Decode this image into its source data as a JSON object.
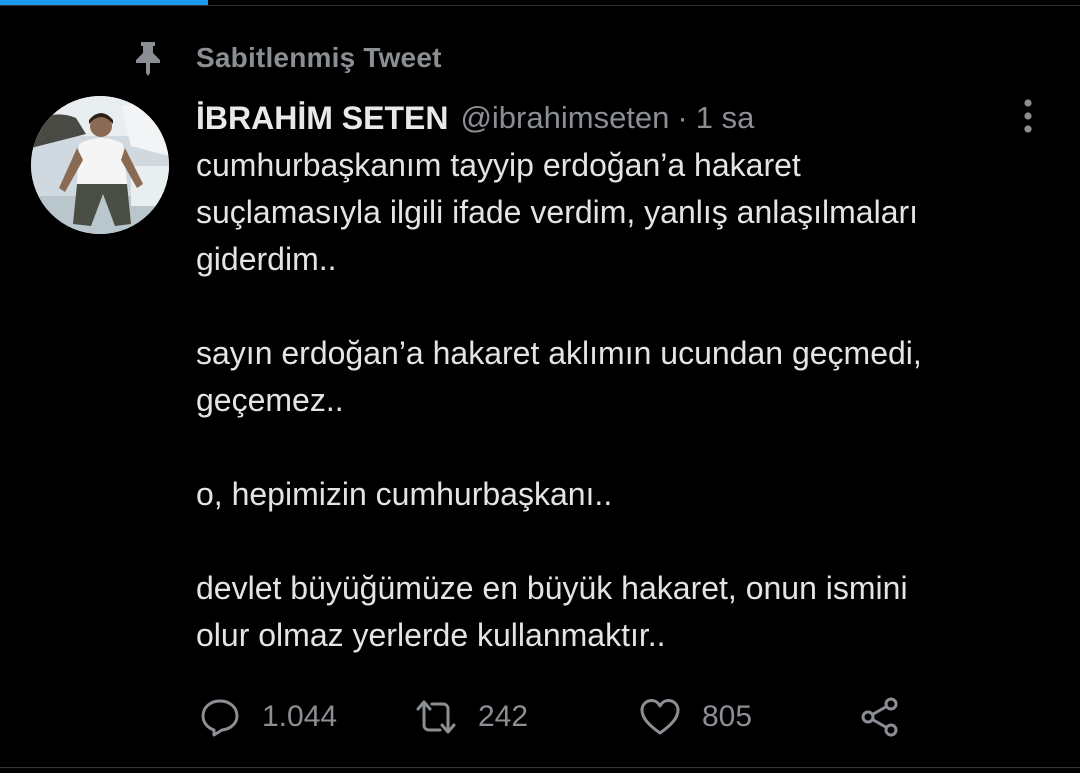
{
  "pinned": {
    "label": "Sabitlenmiş Tweet",
    "icon": "pin-icon"
  },
  "tweet": {
    "display_name": "İBRAHİM SETEN",
    "handle": "@ibrahimseten",
    "separator": "·",
    "time": "1 sa",
    "paragraphs": [
      "cumhurbaşkanım tayyip erdoğan’a hakaret\nsuçlamasıyla ilgili ifade verdim, yanlış anlaşılmaları\ngiderdim..",
      "sayın erdoğan’a hakaret aklımın ucundan geçmedi,\ngeçemez..",
      "o, hepimizin cumhurbaşkanı..",
      "devlet büyüğümüze en büyük hakaret, onun ismini\nolur olmaz yerlerde kullanmaktır.."
    ]
  },
  "actions": {
    "reply": {
      "icon": "reply-icon",
      "count": "1.044"
    },
    "retweet": {
      "icon": "retweet-icon",
      "count": "242"
    },
    "like": {
      "icon": "heart-icon",
      "count": "805"
    },
    "share": {
      "icon": "share-icon"
    }
  },
  "colors": {
    "background": "#000000",
    "text_primary": "#e7e9ea",
    "text_secondary": "#8b8f94",
    "accent": "#1d9bf0",
    "divider": "#2f3336"
  }
}
